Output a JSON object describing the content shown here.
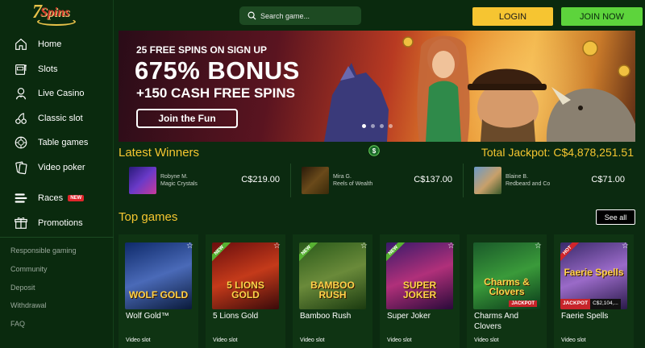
{
  "logo": {
    "seven": "7",
    "word": "Spins"
  },
  "nav": {
    "items": [
      {
        "label": "Home",
        "icon": "home-icon"
      },
      {
        "label": "Slots",
        "icon": "slot-machine-icon"
      },
      {
        "label": "Live Casino",
        "icon": "dealer-icon"
      },
      {
        "label": "Classic slot",
        "icon": "cherries-icon"
      },
      {
        "label": "Table games",
        "icon": "chip-icon"
      },
      {
        "label": "Video poker",
        "icon": "cards-icon"
      }
    ],
    "races": {
      "label": "Races",
      "badge": "NEW"
    },
    "promotions": {
      "label": "Promotions"
    }
  },
  "footer_links": [
    "Responsible gaming",
    "Community",
    "Deposit",
    "Withdrawal",
    "FAQ"
  ],
  "header": {
    "search_placeholder": "Search game...",
    "login": "LOGIN",
    "join": "JOIN NOW"
  },
  "banner": {
    "small": "25 FREE SPINS ON SIGN UP",
    "big": "675% BONUS",
    "mid": "+150 CASH FREE SPINS",
    "cta": "Join the Fun",
    "active_slide": 1,
    "slide_count": 4
  },
  "winners": {
    "title": "Latest Winners",
    "jackpot_label": "Total Jackpot:",
    "jackpot_value": "C$4,878,251.51",
    "list": [
      {
        "name": "Robyne M.",
        "game": "Magic Crystals",
        "amount": "C$219.00",
        "color": "#3a2a8a"
      },
      {
        "name": "Mira G.",
        "game": "Reels of Wealth",
        "amount": "C$137.00",
        "color": "#3a2a12"
      },
      {
        "name": "Blaine B.",
        "game": "Redbeard and Co",
        "amount": "C$71.00",
        "color": "#4a7a9a"
      }
    ]
  },
  "top_games": {
    "title": "Top games",
    "see_all": "See all",
    "games": [
      {
        "name": "Wolf Gold™",
        "category": "Video slot",
        "art_text": "WOLF GOLD",
        "ribbon": "",
        "jackpot": "",
        "bg": "linear-gradient(160deg,#0e2a6a,#4a6ab8 50%,#0a1a3a)"
      },
      {
        "name": "5 Lions Gold",
        "category": "Video slot",
        "art_text": "5 LIONS GOLD",
        "ribbon": "NEW",
        "jackpot": "",
        "bg": "linear-gradient(160deg,#6a0e0e,#c43a1a 50%,#3a0a0a)"
      },
      {
        "name": "Bamboo Rush",
        "category": "Video slot",
        "art_text": "BAMBOO RUSH",
        "ribbon": "NEW",
        "jackpot": "",
        "bg": "linear-gradient(160deg,#2a5a1a,#6a8a3a 50%,#1a3a10)"
      },
      {
        "name": "Super Joker",
        "category": "Video slot",
        "art_text": "SUPER JOKER",
        "ribbon": "NEW",
        "jackpot": "",
        "bg": "linear-gradient(160deg,#3a1a6a,#b0307a 50%,#2a0a3a)"
      },
      {
        "name": "Charms And Clovers",
        "category": "Video slot",
        "art_text": "Charms & Clovers",
        "ribbon": "",
        "jackpot": "JACKPOT",
        "bg": "linear-gradient(160deg,#1a5a2a,#3a9a3a 50%,#0a3a1a)"
      },
      {
        "name": "Faerie Spells",
        "category": "Video slot",
        "art_text": "Faerie Spells",
        "ribbon": "HOT",
        "jackpot": "JACKPOT",
        "jackpot_amount": "C$2,104,...",
        "bg": "linear-gradient(160deg,#3a2a6a,#9a6ac8 50%,#2a1a4a)"
      }
    ]
  }
}
